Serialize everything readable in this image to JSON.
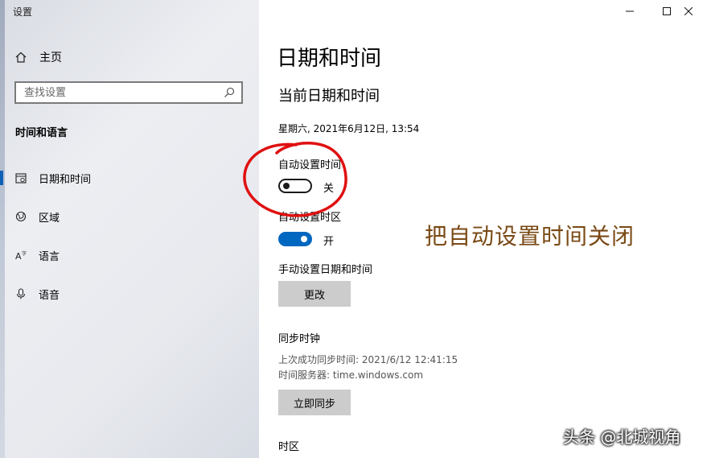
{
  "window": {
    "title": "设置",
    "controls": {
      "minimize": "─",
      "maximize": "☐",
      "close": "✕"
    }
  },
  "sidebar": {
    "home": {
      "label": "主页",
      "icon": "home-icon"
    },
    "search": {
      "placeholder": "查找设置",
      "icon": "search-icon"
    },
    "section_title": "时间和语言",
    "items": [
      {
        "label": "日期和时间",
        "icon": "calendar-clock-icon",
        "active": true
      },
      {
        "label": "区域",
        "icon": "globe-icon",
        "active": false
      },
      {
        "label": "语言",
        "icon": "language-icon",
        "active": false
      },
      {
        "label": "语音",
        "icon": "microphone-icon",
        "active": false
      }
    ]
  },
  "main": {
    "title": "日期和时间",
    "subtitle": "当前日期和时间",
    "current_datetime": "星期六, 2021年6月12日, 13:54",
    "auto_time": {
      "label": "自动设置时间",
      "state": "关",
      "on": false
    },
    "auto_timezone": {
      "label": "自动设置时区",
      "state": "开",
      "on": true
    },
    "manual": {
      "label": "手动设置日期和时间",
      "button": "更改"
    },
    "sync": {
      "title": "同步时钟",
      "last_sync": "上次成功同步时间: 2021/6/12 12:41:15",
      "server": "时间服务器: time.windows.com",
      "button": "立即同步"
    },
    "timezone_title": "时区"
  },
  "annotation": {
    "text": "把自动设置时间关闭",
    "color": "#7a4a15",
    "circle_color": "#e01010"
  },
  "watermark": "头条 @北城视角",
  "colors": {
    "accent": "#0067c0",
    "button_bg": "#cccccc",
    "sidebar_bg": "#e7e9ee"
  }
}
